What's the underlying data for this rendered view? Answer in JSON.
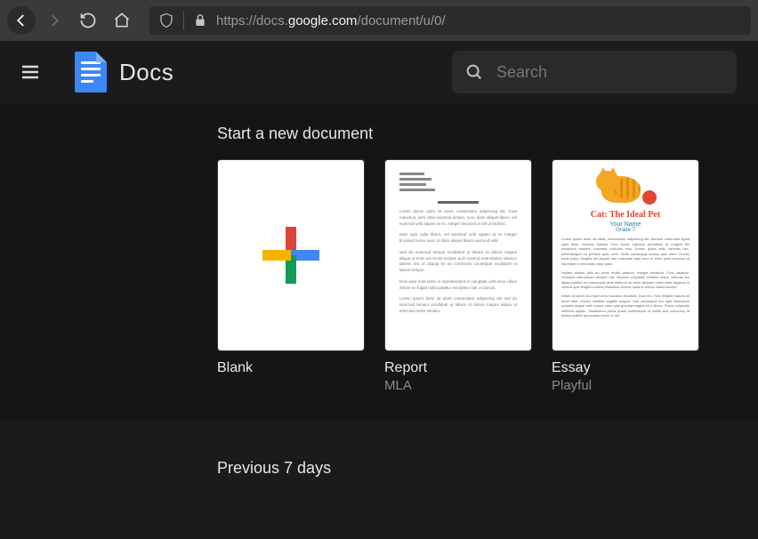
{
  "browser": {
    "url_prefix": "https://docs.",
    "url_domain": "google.com",
    "url_path": "/document/u/0/"
  },
  "header": {
    "app_title": "Docs",
    "search_placeholder": "Search"
  },
  "templates": {
    "section_label": "Start a new document",
    "items": [
      {
        "title": "Blank",
        "subtitle": ""
      },
      {
        "title": "Report",
        "subtitle": "MLA"
      },
      {
        "title": "Essay",
        "subtitle": "Playful"
      }
    ]
  },
  "essay_preview": {
    "title": "Cat: The Ideal Pet",
    "name": "Your Name",
    "grade": "Grade 7"
  },
  "recent": {
    "label": "Previous 7 days"
  }
}
